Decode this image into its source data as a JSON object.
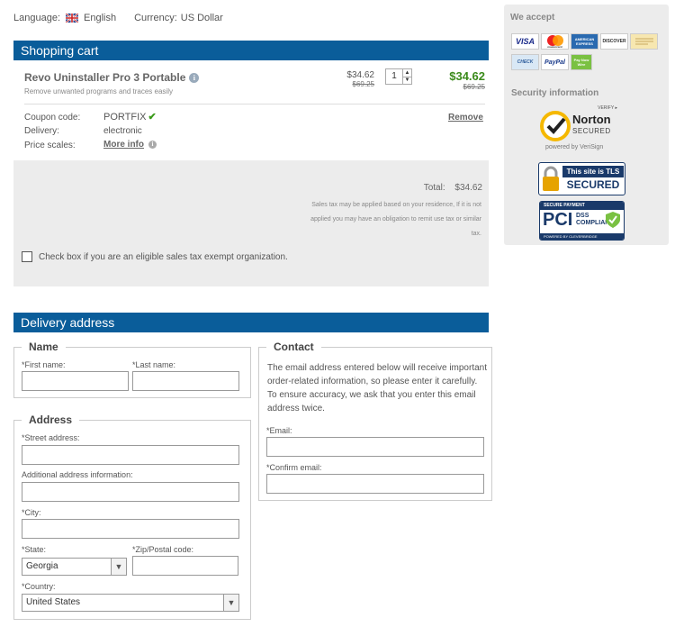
{
  "topbar": {
    "language_label": "Language:",
    "language_value": "English",
    "currency_label": "Currency:",
    "currency_value": "US Dollar"
  },
  "cart": {
    "header": "Shopping cart",
    "product_name": "Revo Uninstaller Pro 3 Portable",
    "product_desc": "Remove unwanted programs and traces easily",
    "unit_price": "$34.62",
    "unit_old_price": "$69.25",
    "quantity": "1",
    "line_price": "$34.62",
    "line_old_price": "$69.25",
    "coupon_label": "Coupon code:",
    "coupon_value": "PORTFIX",
    "delivery_label": "Delivery:",
    "delivery_value": "electronic",
    "scales_label": "Price scales:",
    "scales_link": "More info",
    "remove_link": "Remove",
    "total_label": "Total:",
    "total_value": "$34.62",
    "tax_line1": "Sales tax may be applied based on your residence, If it is not",
    "tax_line2": "applied you may have an obligation to remit use tax or similar",
    "tax_line3": "tax.",
    "exempt_label": "Check box if you are an eligible sales tax exempt organization."
  },
  "delivery": {
    "header": "Delivery address",
    "name_legend": "Name",
    "first_name_label": "*First name:",
    "last_name_label": "*Last name:",
    "address_legend": "Address",
    "street_label": "*Street address:",
    "additional_label": "Additional address information:",
    "city_label": "*City:",
    "state_label": "*State:",
    "state_value": "Georgia",
    "zip_label": "*Zip/Postal code:",
    "country_label": "*Country:",
    "country_value": "United States",
    "contact_legend": "Contact",
    "contact_text": "The email address entered below will receive important order-related information, so please enter it carefully. To ensure accuracy, we ask that you enter this email address twice.",
    "email_label": "*Email:",
    "confirm_email_label": "*Confirm email:"
  },
  "side": {
    "we_accept": "We accept",
    "cards": [
      "VISA",
      "mastercard",
      "AMERICAN EXPRESS",
      "DISCOVER",
      "CHECK",
      "PayPal",
      "Pay Now Wire"
    ],
    "security_title": "Security information",
    "norton_verify": "VERIFY ▸",
    "norton_name": "Norton",
    "norton_secured": "SECURED",
    "norton_powered": "powered by VeriSign",
    "tls_line1": "This site is TLS",
    "tls_line2": "SECURED",
    "pci_top": "SECURE PAYMENT",
    "pci_big": "PCI",
    "pci_dss": "DSS",
    "pci_compliant": "COMPLIANT",
    "pci_powered": "POWERED BY CLEVERBRIDGE"
  },
  "colors": {
    "header_blue": "#0a5d9a",
    "price_green": "#3a8a1a",
    "panel_gray": "#ececec"
  }
}
